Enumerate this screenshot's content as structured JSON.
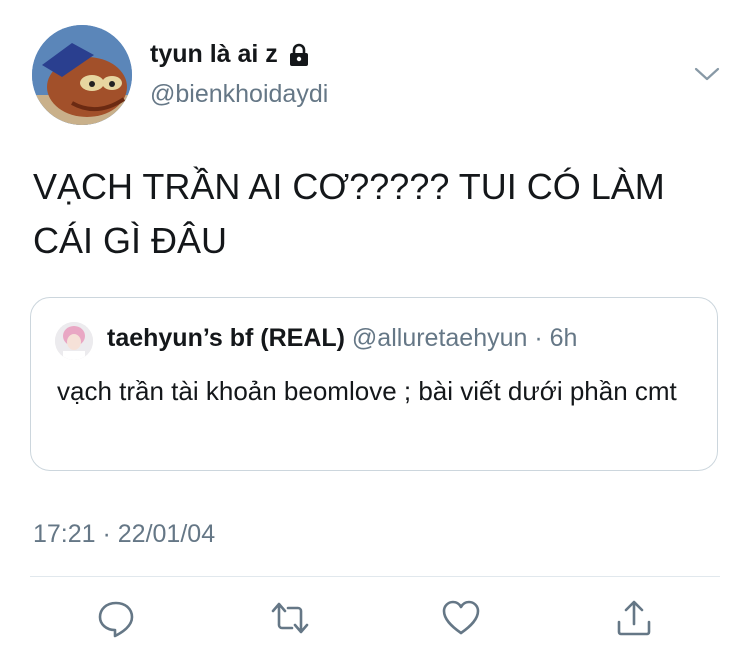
{
  "tweet": {
    "author": {
      "display_name": "tyun là ai z",
      "handle": "@bienkhoidaydi",
      "avatar_icon": "cartoon-fish-avatar",
      "protected_icon": "lock-icon"
    },
    "text": "VẠCH TRẦN AI CƠ????? TUI CÓ LÀM CÁI GÌ ĐÂU",
    "timestamp": "17:21 · 22/01/04",
    "menu_icon": "chevron-down-icon"
  },
  "quoted_tweet": {
    "display_name": "taehyun’s bf (REAL)",
    "handle_time": "@alluretaehyun · 6h",
    "text": "vạch trần tài khoản beomlove ; bài viết dưới phần cmt",
    "avatar_icon": "pink-hair-person-avatar"
  },
  "actions": [
    {
      "name": "reply",
      "icon": "speech-bubble-icon"
    },
    {
      "name": "retweet",
      "icon": "retweet-arrows-icon"
    },
    {
      "name": "like",
      "icon": "heart-icon"
    },
    {
      "name": "share",
      "icon": "share-upload-icon"
    }
  ],
  "colors": {
    "text": "#14171a",
    "secondary": "#657786",
    "border": "#ccd6dd",
    "icons": "#657786"
  }
}
